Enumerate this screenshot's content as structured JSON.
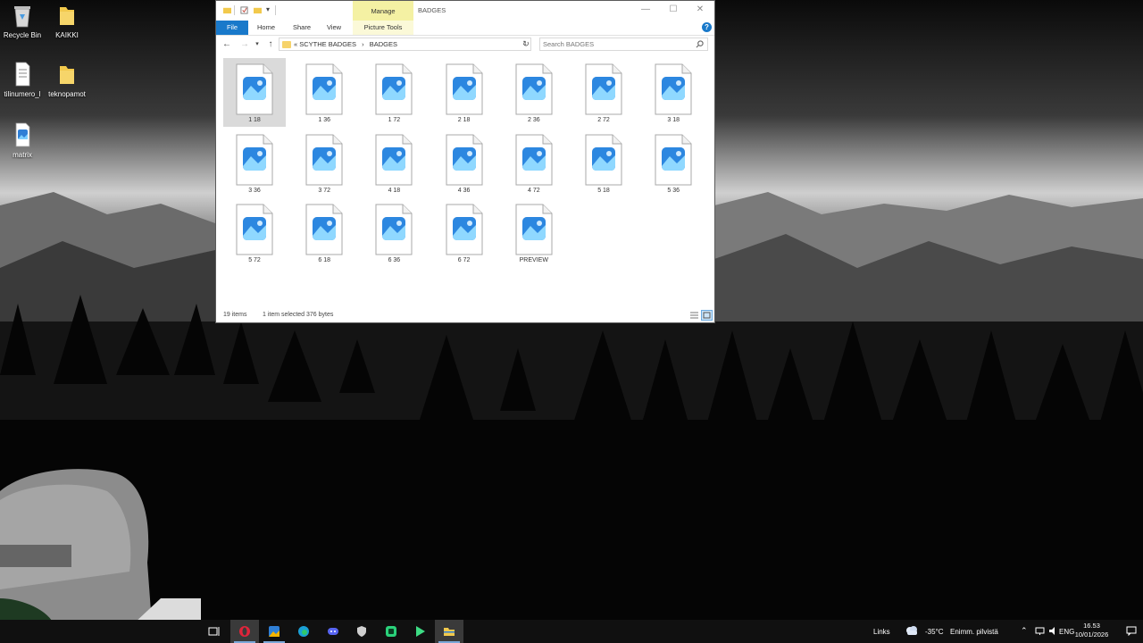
{
  "desktop": {
    "icons": [
      {
        "label": "Recycle Bin",
        "icon": "recycle-bin-icon"
      },
      {
        "label": "KAIKKI",
        "icon": "folder-icon"
      },
      {
        "label": "tilinumero_l",
        "icon": "text-file-icon"
      },
      {
        "label": "teknopamot",
        "icon": "folder-icon"
      },
      {
        "label": "matrix",
        "icon": "image-file-icon"
      }
    ]
  },
  "explorer": {
    "title": "BADGES",
    "context_tab": "Manage",
    "ribbon_tabs": [
      "File",
      "Home",
      "Share",
      "View",
      "Picture Tools"
    ],
    "breadcrumb": {
      "prefix": "«",
      "parent": "SCYTHE BADGES",
      "separator": "›",
      "current": "BADGES"
    },
    "search_placeholder": "Search BADGES",
    "files": [
      {
        "name": "1 18",
        "selected": true
      },
      {
        "name": "1 36",
        "selected": false
      },
      {
        "name": "1 72",
        "selected": false
      },
      {
        "name": "2 18",
        "selected": false
      },
      {
        "name": "2 36",
        "selected": false
      },
      {
        "name": "2 72",
        "selected": false
      },
      {
        "name": "3 18",
        "selected": false
      },
      {
        "name": "3 36",
        "selected": false
      },
      {
        "name": "3 72",
        "selected": false
      },
      {
        "name": "4 18",
        "selected": false
      },
      {
        "name": "4 36",
        "selected": false
      },
      {
        "name": "4 72",
        "selected": false
      },
      {
        "name": "5 18",
        "selected": false
      },
      {
        "name": "5 36",
        "selected": false
      },
      {
        "name": "5 72",
        "selected": false
      },
      {
        "name": "6 18",
        "selected": false
      },
      {
        "name": "6 36",
        "selected": false
      },
      {
        "name": "6 72",
        "selected": false
      },
      {
        "name": "PREVIEW",
        "selected": false
      }
    ],
    "status": {
      "count": "19 items",
      "selected": "1 item selected  376 bytes"
    },
    "accent_color": "#1979ca",
    "context_color": "#f4f1a3"
  },
  "taskbar": {
    "apps": [
      {
        "icon": "task-view-icon"
      },
      {
        "icon": "opera-icon"
      },
      {
        "icon": "photos-icon"
      },
      {
        "icon": "edge-icon"
      },
      {
        "icon": "discord-icon"
      },
      {
        "icon": "app-shield-icon"
      },
      {
        "icon": "app-green-icon"
      },
      {
        "icon": "play-icon"
      },
      {
        "icon": "file-explorer-icon"
      }
    ],
    "links_label": "Links",
    "weather": {
      "temp": "-35°C",
      "desc": "Enimm. pilvistä"
    },
    "language": "ENG",
    "time": "16.53",
    "date": "10/01/2026"
  }
}
